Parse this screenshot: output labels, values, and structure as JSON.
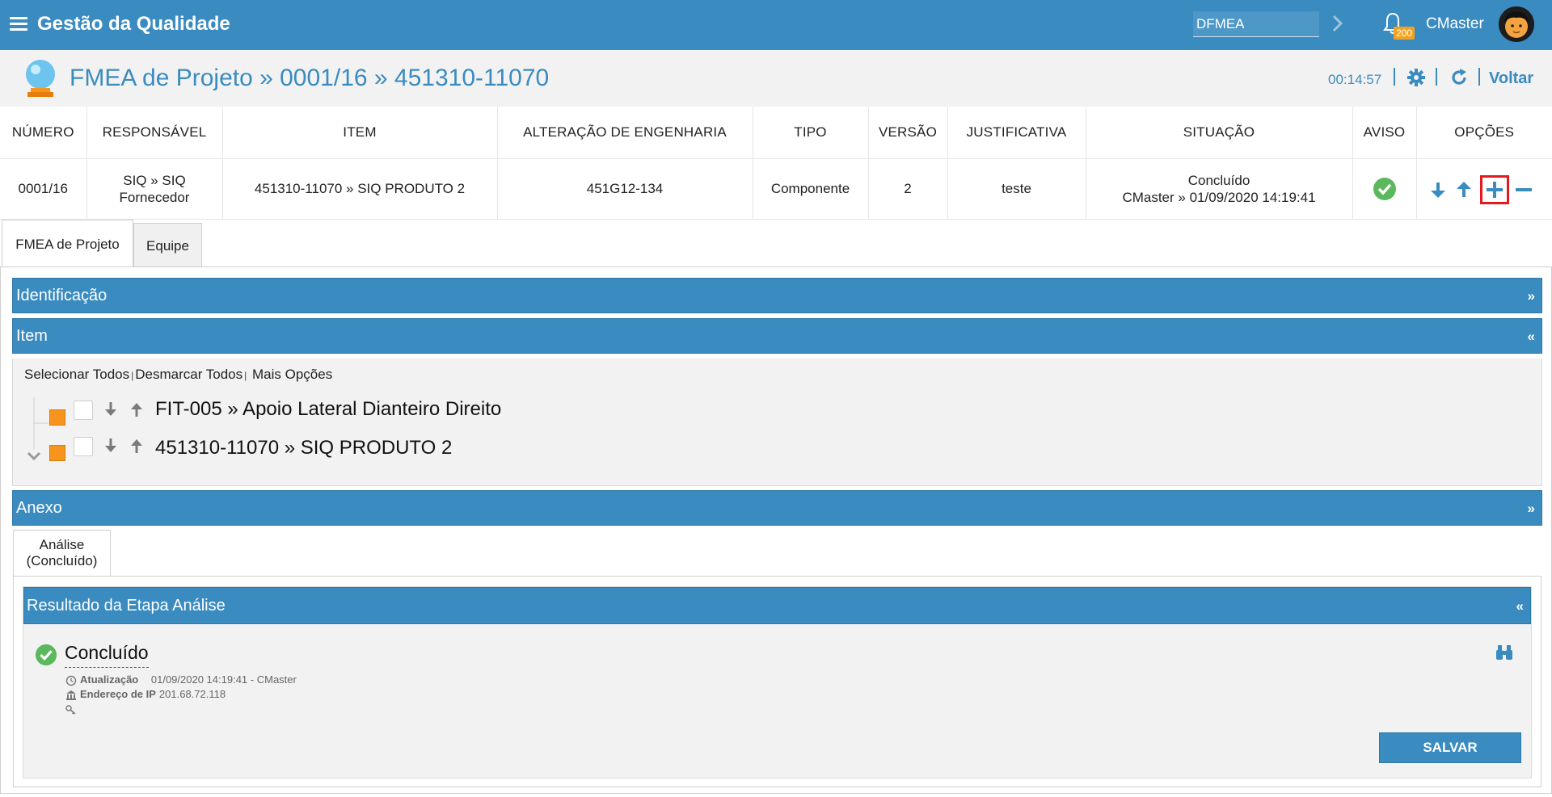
{
  "topbar": {
    "app_title": "Gestão da Qualidade",
    "module_search_value": "DFMEA",
    "notification_count": "200",
    "user_name": "CMaster"
  },
  "header": {
    "title": "FMEA de Projeto » 0001/16 » 451310-11070",
    "timer": "00:14:57",
    "back_label": "Voltar"
  },
  "summary": {
    "columns": [
      "NÚMERO",
      "RESPONSÁVEL",
      "ITEM",
      "ALTERAÇÃO DE ENGENHARIA",
      "TIPO",
      "VERSÃO",
      "JUSTIFICATIVA",
      "SITUAÇÃO",
      "AVISO",
      "OPÇÕES"
    ],
    "row": {
      "numero": "0001/16",
      "responsavel_line1": "SIQ » SIQ",
      "responsavel_line2": "Fornecedor",
      "item": "451310-11070 » SIQ PRODUTO 2",
      "alteracao": "451G12-134",
      "tipo": "Componente",
      "versao": "2",
      "justificativa": "teste",
      "situacao_line1": "Concluído",
      "situacao_line2": "CMaster » 01/09/2020 14:19:41"
    }
  },
  "tabs": [
    {
      "label": "FMEA de Projeto",
      "active": true
    },
    {
      "label": "Equipe",
      "active": false
    }
  ],
  "panels": {
    "identificacao": "Identificação",
    "item": "Item",
    "anexo": "Anexo",
    "collapsed_chevron": "»",
    "expanded_chevron": "«"
  },
  "item_actions": {
    "select_all": "Selecionar Todos",
    "deselect_all": "Desmarcar Todos",
    "more_options": "Mais Opções",
    "separator": "|"
  },
  "tree": [
    {
      "name": "FIT-005 » Apoio Lateral Dianteiro Direito"
    },
    {
      "name": "451310-11070 » SIQ PRODUTO 2"
    }
  ],
  "analysis": {
    "sub_tab_line1": "Análise",
    "sub_tab_line2": "(Concluído)",
    "result_title": "Resultado da Etapa Análise",
    "status": "Concluído",
    "update_label": "Atualização",
    "update_value": "01/09/2020 14:19:41",
    "update_user": "- CMaster",
    "ip_label": "Endereço de IP",
    "ip_value": "201.68.72.118",
    "save_label": "SALVAR"
  },
  "colors": {
    "primary": "#3a8bbf",
    "success": "#5cb85c",
    "badge": "#f2a21d",
    "node": "#f7941d",
    "highlight_border": "#e5181f"
  },
  "icons": [
    "menu-icon",
    "chevron-right-icon",
    "bell-icon",
    "avatar",
    "crystal-ball-icon",
    "gear-icon",
    "refresh-icon",
    "check-circle-icon",
    "arrow-down-icon",
    "arrow-up-icon",
    "plus-icon",
    "minus-icon",
    "binoculars-icon",
    "clock-icon",
    "bank-icon",
    "key-icon"
  ]
}
